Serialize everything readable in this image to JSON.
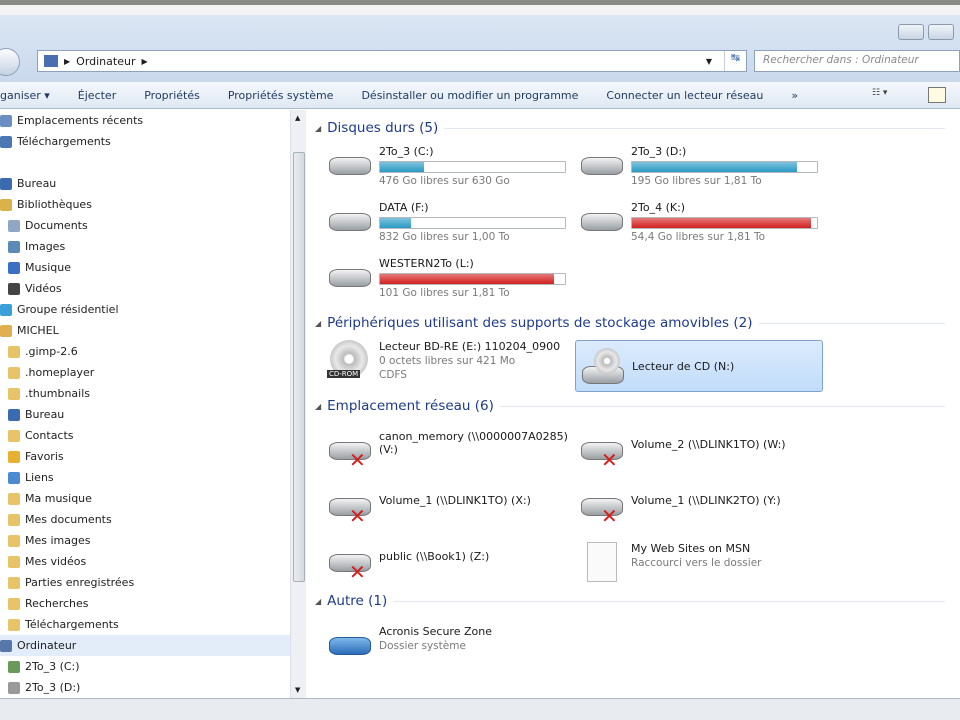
{
  "address": {
    "path": "Ordinateur",
    "search_placeholder": "Rechercher dans : Ordinateur"
  },
  "toolbar": {
    "items": [
      "ganiser ▾",
      "Éjecter",
      "Propriétés",
      "Propriétés système",
      "Désinstaller ou modifier un programme",
      "Connecter un lecteur réseau",
      "»"
    ]
  },
  "sidebar": {
    "items": [
      {
        "label": "Emplacements récents",
        "indent": 0,
        "color": "#6a8fc0"
      },
      {
        "label": "Téléchargements",
        "indent": 0,
        "color": "#4a78b5"
      },
      {
        "label": "",
        "indent": 0,
        "color": ""
      },
      {
        "label": "Bureau",
        "indent": 0,
        "color": "#3a6ab0"
      },
      {
        "label": "Bibliothèques",
        "indent": 0,
        "color": "#d9b24a"
      },
      {
        "label": "Documents",
        "indent": 1,
        "color": "#8fa6c4"
      },
      {
        "label": "Images",
        "indent": 1,
        "color": "#5c8ab8"
      },
      {
        "label": "Musique",
        "indent": 1,
        "color": "#3b6fc4"
      },
      {
        "label": "Vidéos",
        "indent": 1,
        "color": "#444"
      },
      {
        "label": "Groupe résidentiel",
        "indent": 0,
        "color": "#3aa0d8"
      },
      {
        "label": "MICHEL",
        "indent": 0,
        "color": "#e0b050"
      },
      {
        "label": ".gimp-2.6",
        "indent": 1,
        "color": "#e8c468"
      },
      {
        "label": ".homeplayer",
        "indent": 1,
        "color": "#e8c468"
      },
      {
        "label": ".thumbnails",
        "indent": 1,
        "color": "#e8c468"
      },
      {
        "label": "Bureau",
        "indent": 1,
        "color": "#3a6ab0"
      },
      {
        "label": "Contacts",
        "indent": 1,
        "color": "#e8c468"
      },
      {
        "label": "Favoris",
        "indent": 1,
        "color": "#e8b030"
      },
      {
        "label": "Liens",
        "indent": 1,
        "color": "#4a8ad0"
      },
      {
        "label": "Ma musique",
        "indent": 1,
        "color": "#e8c468"
      },
      {
        "label": "Mes documents",
        "indent": 1,
        "color": "#e8c468"
      },
      {
        "label": "Mes images",
        "indent": 1,
        "color": "#e8c468"
      },
      {
        "label": "Mes vidéos",
        "indent": 1,
        "color": "#e8c468"
      },
      {
        "label": "Parties enregistrées",
        "indent": 1,
        "color": "#e8c468"
      },
      {
        "label": "Recherches",
        "indent": 1,
        "color": "#e8c468"
      },
      {
        "label": "Téléchargements",
        "indent": 1,
        "color": "#e8c468"
      },
      {
        "label": "Ordinateur",
        "indent": 0,
        "color": "#5577aa",
        "selected": true
      },
      {
        "label": "2To_3 (C:)",
        "indent": 1,
        "color": "#6a9a5a"
      },
      {
        "label": "2To_3 (D:)",
        "indent": 1,
        "color": "#999"
      }
    ]
  },
  "groups": {
    "hdd": "Disques durs (5)",
    "removable": "Périphériques utilisant des supports de stockage amovibles (2)",
    "network": "Emplacement réseau (6)",
    "other": "Autre (1)"
  },
  "drives": [
    {
      "name": "2To_3 (C:)",
      "free": "476 Go libres sur 630 Go",
      "used_fraction": 0.24,
      "color": "#2a9ac4"
    },
    {
      "name": "2To_3 (D:)",
      "free": "195 Go libres sur 1,81 To",
      "used_fraction": 0.89,
      "color": "#2a9ac4"
    },
    {
      "name": "DATA (F:)",
      "free": "832 Go libres sur 1,00 To",
      "used_fraction": 0.17,
      "color": "#2a9ac4"
    },
    {
      "name": "2To_4 (K:)",
      "free": "54,4 Go libres sur 1,81 To",
      "used_fraction": 0.97,
      "color": "#d42020"
    },
    {
      "name": "WESTERN2To (L:)",
      "free": "101 Go libres sur 1,81 To",
      "used_fraction": 0.94,
      "color": "#d42020"
    }
  ],
  "removable": [
    {
      "name": "Lecteur BD-RE (E:) 110204_0900",
      "free": "0 octets libres sur 421 Mo",
      "fs": "CDFS",
      "badge": "CD-ROM"
    },
    {
      "name": "Lecteur de CD (N:)"
    }
  ],
  "network": [
    {
      "name": "canon_memory (\\\\0000007A0285)",
      "name2": "(V:)"
    },
    {
      "name": "Volume_2 (\\\\DLINK1TO) (W:)"
    },
    {
      "name": "Volume_1 (\\\\DLINK1TO) (X:)"
    },
    {
      "name": "Volume_1 (\\\\DLINK2TO) (Y:)"
    },
    {
      "name": "public (\\\\Book1) (Z:)"
    },
    {
      "name": "My Web Sites on MSN",
      "sub": "Raccourci vers le dossier"
    }
  ],
  "other": [
    {
      "name": "Acronis Secure Zone",
      "sub": "Dossier système"
    }
  ]
}
